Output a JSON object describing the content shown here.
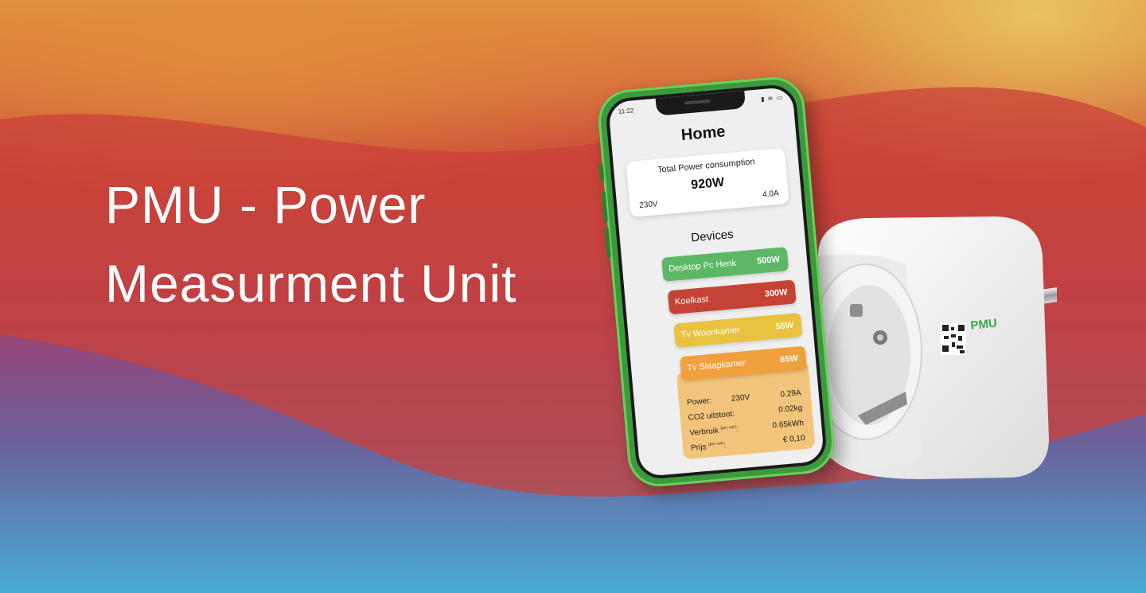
{
  "headline": {
    "line1": "PMU - Power",
    "line2": "Measurment Unit"
  },
  "phone": {
    "status_time": "11:22",
    "status_icons": "▮ ≋ ▭",
    "title": "Home",
    "total": {
      "label": "Total Power consumption",
      "value": "920W",
      "voltage": "230V",
      "current": "4.0A"
    },
    "devices_title": "Devices",
    "devices": [
      {
        "name": "Desktop Pc Henk",
        "watt": "500W",
        "color": "#5cb866"
      },
      {
        "name": "Koelkast",
        "watt": "300W",
        "color": "#c54336"
      },
      {
        "name": "Tv Woonkamer",
        "watt": "55W",
        "color": "#e9c23f"
      },
      {
        "name": "Tv Slaapkamer",
        "watt": "65W",
        "color": "#f0a03c"
      }
    ],
    "detail": {
      "power_label": "Power:",
      "power_voltage": "230V",
      "power_current": "0.29A",
      "co2_label": "CO2 uitstoot:",
      "co2_value": "0.02kg",
      "usage_label": "Verbruik",
      "usage_sup": "(per uur)",
      "usage_value": "0.65kWh",
      "price_label": "Prijs",
      "price_sup": "(per uur)",
      "price_value": "€ 0,10"
    }
  },
  "plug": {
    "brand": "PMU",
    "brand_color": "#39a845"
  }
}
